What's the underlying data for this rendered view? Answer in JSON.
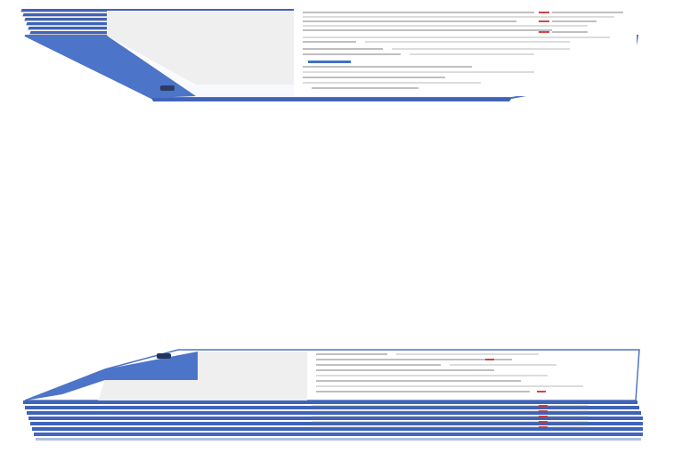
{
  "scene": {
    "description_hidden": false,
    "colors": {
      "sheet_blue": "#3f63b8",
      "panel_blue": "#4c74c8",
      "panel_gray": "#efefef",
      "page_white": "#ffffff",
      "accent_red": "#d52d2d"
    }
  },
  "top_stack": {
    "label": ""
  },
  "bottom_stack": {
    "label": ""
  }
}
